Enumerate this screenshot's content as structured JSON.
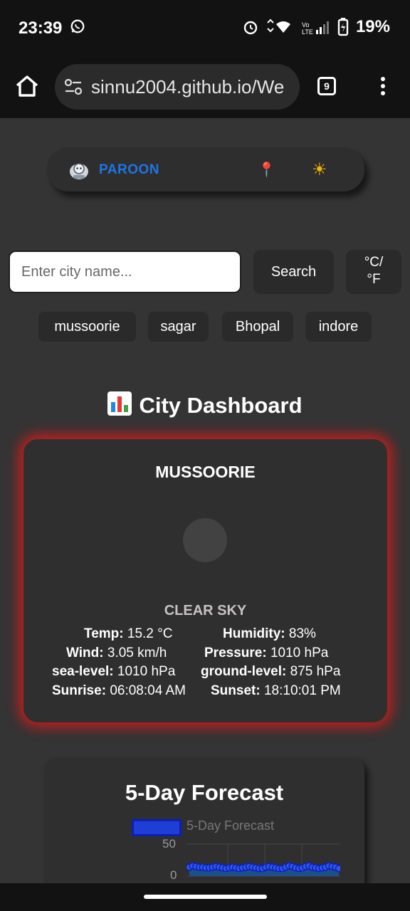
{
  "status": {
    "time": "23:39",
    "battery": "19%"
  },
  "browser": {
    "url": "sinnu2004.github.io/We",
    "tab_count": "9"
  },
  "nav": {
    "brand": "PAROON"
  },
  "search": {
    "placeholder": "Enter city name...",
    "button_label": "Search",
    "unit_line1": "°C/",
    "unit_line2": "°F"
  },
  "recent_cities": [
    "mussoorie",
    "sagar",
    "Bhopal",
    "indore"
  ],
  "dashboard": {
    "title": "City Dashboard"
  },
  "weather": {
    "city": "MUSSOORIE",
    "condition": "CLEAR SKY",
    "temp_label": "Temp:",
    "temp": "15.2 °C",
    "humidity_label": "Humidity:",
    "humidity": "83%",
    "wind_label": "Wind:",
    "wind": "3.05 km/h",
    "pressure_label": "Pressure:",
    "pressure": "1010 hPa",
    "sea_level_label": "sea-level:",
    "sea_level": "1010 hPa",
    "ground_level_label": "ground-level:",
    "ground_level": "875 hPa",
    "sunrise_label": "Sunrise:",
    "sunrise": "06:08:04 AM",
    "sunset_label": "Sunset:",
    "sunset": "18:10:01 PM"
  },
  "forecast": {
    "title": "5-Day Forecast"
  },
  "chart_data": {
    "type": "line",
    "series": [
      {
        "name": "5-Day Forecast",
        "values": [
          14,
          16,
          15,
          14,
          14,
          13,
          13,
          14,
          15,
          14,
          13,
          12,
          13,
          14,
          13,
          12,
          13,
          14,
          15,
          14,
          13,
          12,
          12,
          14,
          15,
          14,
          13,
          12,
          12,
          14,
          16,
          15,
          13,
          12,
          13,
          15,
          16,
          14,
          13,
          12,
          13,
          14,
          16,
          15,
          14,
          12
        ]
      }
    ],
    "ylim": [
      0,
      50
    ],
    "yticks": [
      "50",
      "0"
    ],
    "colors": {
      "line": "#1e3ed6",
      "fill": "#1f4f8a"
    }
  }
}
